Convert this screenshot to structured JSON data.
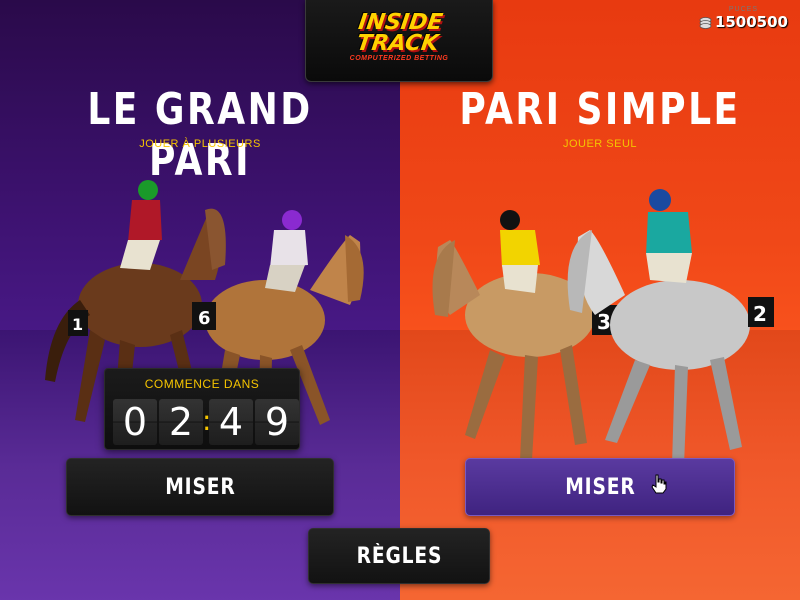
{
  "logo": {
    "text": "INSIDE\nTRACK",
    "tagline": "COMPUTERIZED BETTING"
  },
  "chips": {
    "label": "PUCES",
    "value": "1500500",
    "icon": "chips-icon"
  },
  "left_panel": {
    "title": "LE GRAND PARI",
    "subtitle": "JOUER À PLUSIEURS",
    "countdown": {
      "label": "COMMENCE DANS",
      "digits": [
        "0",
        "2",
        "4",
        "9"
      ],
      "separator": ":"
    },
    "bet_button": "MISER",
    "horse_numbers": [
      "1",
      "6"
    ]
  },
  "right_panel": {
    "title": "PARI SIMPLE",
    "subtitle": "JOUER SEUL",
    "bet_button": "MISER",
    "horse_numbers": [
      "3",
      "2"
    ]
  },
  "rules_button": "RÈGLES",
  "colors": {
    "left_bg": "#3d1270",
    "right_bg": "#f04818",
    "accent_yellow": "#f5c400",
    "button_purple": "#4a2c8c"
  }
}
